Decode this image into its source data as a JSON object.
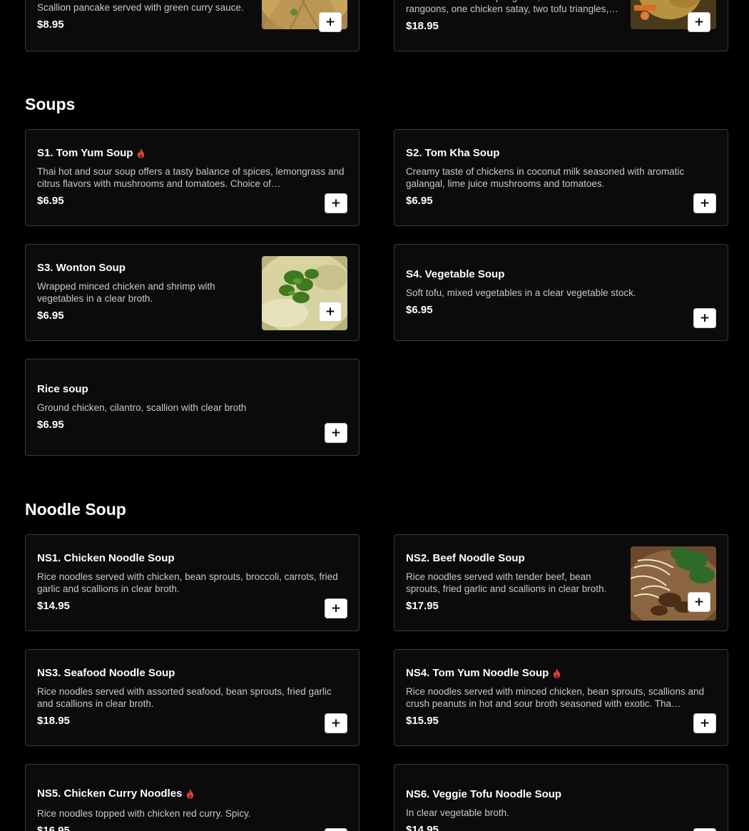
{
  "colors": {
    "background": "#000000",
    "card_border": "#3a3a3a",
    "spicy_icon": "#e0443a"
  },
  "top_partial": [
    {
      "description": "Scallion pancake served with green curry sauce.",
      "price": "$8.95",
      "has_image": true
    },
    {
      "description": "Combination of two spring rolls, two crab rangoons, one chicken satay, two tofu triangles, …",
      "price": "$18.95",
      "has_image": true
    }
  ],
  "sections": [
    {
      "title": "Soups",
      "items": [
        {
          "name": "S1. Tom Yum Soup",
          "spicy": true,
          "description": "Thai hot and sour soup offers a tasty balance of spices, lemongrass and citrus flavors with mushrooms and tomatoes. Choice of…",
          "price": "$6.95"
        },
        {
          "name": "S2. Tom Kha Soup",
          "description": "Creamy taste of chickens in coconut milk seasoned with aromatic galangal, lime juice mushrooms and tomatoes.",
          "price": "$6.95"
        },
        {
          "name": "S3. Wonton Soup",
          "description": "Wrapped minced chicken and shrimp with vegetables in a clear broth.",
          "price": "$6.95",
          "has_image": true
        },
        {
          "name": "S4. Vegetable Soup",
          "description": "Soft tofu, mixed vegetables in a clear vegetable stock.",
          "price": "$6.95"
        },
        {
          "name": "Rice soup",
          "description": "Ground chicken, cilantro, scallion with clear broth",
          "price": "$6.95"
        }
      ]
    },
    {
      "title": "Noodle Soup",
      "items": [
        {
          "name": "NS1. Chicken Noodle Soup",
          "description": "Rice noodles served with chicken, bean sprouts, broccoli, carrots, fried garlic and scallions in clear broth.",
          "price": "$14.95"
        },
        {
          "name": "NS2. Beef Noodle Soup",
          "description": "Rice noodles served with tender beef, bean sprouts, fried garlic and scallions in clear broth.",
          "price": "$17.95",
          "has_image": true
        },
        {
          "name": "NS3. Seafood Noodle Soup",
          "description": "Rice noodles served with assorted seafood, bean sprouts, fried garlic and scallions in clear broth.",
          "price": "$18.95"
        },
        {
          "name": "NS4. Tom Yum Noodle Soup",
          "spicy": true,
          "description": "Rice noodles served with minced chicken, bean sprouts, scallions and crush peanuts in hot and sour broth seasoned with exotic. Tha…",
          "price": "$15.95"
        },
        {
          "name": "NS5. Chicken Curry Noodles",
          "spicy": true,
          "description": "Rice noodles topped with chicken red curry. Spicy.",
          "price": "$16.95"
        },
        {
          "name": "NS6. Veggie Tofu Noodle Soup",
          "description": "In clear vegetable broth.",
          "price": "$14.95"
        }
      ]
    }
  ],
  "add_button_glyph": "+"
}
